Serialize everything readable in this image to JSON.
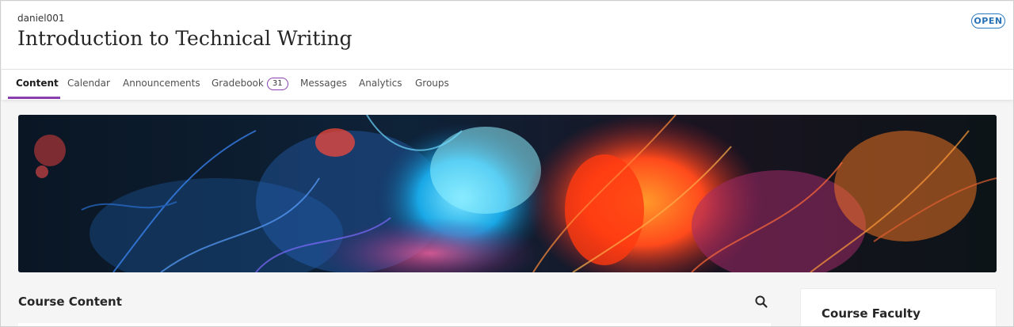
{
  "header": {
    "course_id": "daniel001",
    "course_title": "Introduction to Technical Writing",
    "status_badge": "OPEN"
  },
  "nav": {
    "tabs": [
      {
        "label": "Content",
        "active": true
      },
      {
        "label": "Calendar"
      },
      {
        "label": "Announcements"
      },
      {
        "label": "Gradebook",
        "badge": "31"
      },
      {
        "label": "Messages"
      },
      {
        "label": "Analytics"
      },
      {
        "label": "Groups"
      }
    ]
  },
  "main": {
    "section_title": "Course Content",
    "search_icon": "search-icon"
  },
  "sidebar": {
    "faculty_title": "Course Faculty"
  },
  "colors": {
    "accent": "#8a3fb0",
    "status_blue": "#2670b6"
  }
}
